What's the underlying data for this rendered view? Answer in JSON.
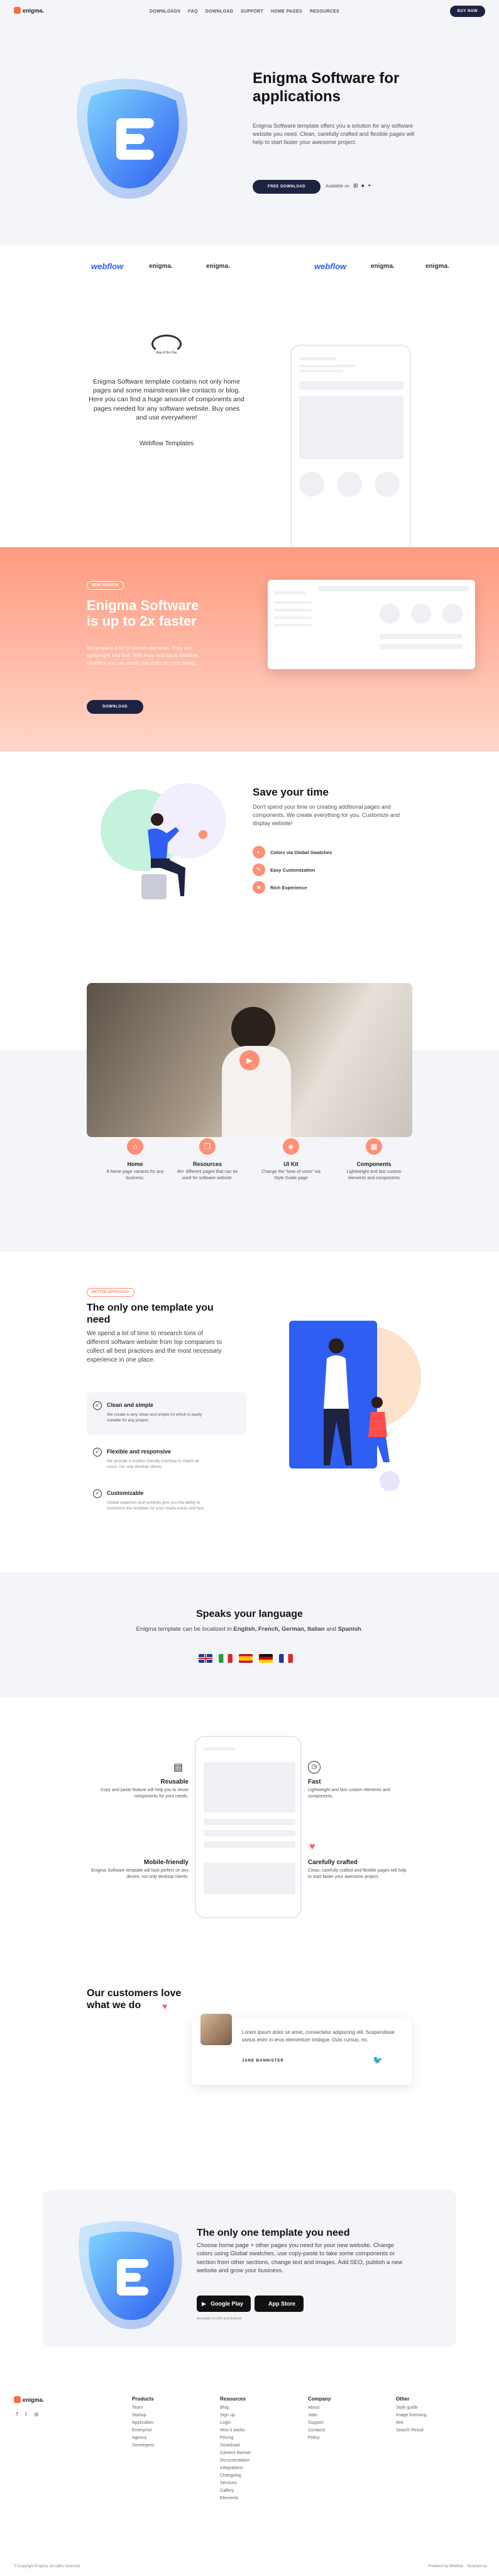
{
  "nav": {
    "logo": "enigma.",
    "links": [
      "DOWNLOADS",
      "FAQ",
      "DOWNLOAD",
      "SUPPORT",
      "HOME PAGES",
      "RESOURCES"
    ],
    "buy": "BUY NOW"
  },
  "hero": {
    "title": "Enigma Software for applications",
    "text": "Enigma Software template offers you a solution for any software website you need. Clean, carefully crafted and flexible pages will help to start faster your awesome project.",
    "button": "FREE DOWNLOAD",
    "available": "Available on"
  },
  "logos": [
    "webflow",
    "enigma.",
    "enigma.",
    "webflow",
    "enigma.",
    "enigma."
  ],
  "about": {
    "badge": "App of the Day",
    "text": "Enigma Software template contains not only home pages and some mainstream like contacts or blog. Here you can find a huge amount of components and pages needed for any software website. Buy ones and use everywhere!",
    "link": "Webflow Templates"
  },
  "promo": {
    "badge": "NEW VERSION",
    "title": "Enigma Software is up to 2x faster",
    "text": "We prepare a lot of custom elements. They are lightweight and fast. With easy and quick Webflow Interface you can easily use them for your needs.",
    "button": "DOWNLOAD"
  },
  "save": {
    "title": "Save your time",
    "text": "Don't spend your time on creating additional pages and components. We create everything for you. Customize and display website!",
    "items": [
      "Colors via Global Swatches",
      "Easy Customization",
      "Rich Experience"
    ]
  },
  "features": [
    {
      "title": "Home",
      "text": "8 home page variants for any business."
    },
    {
      "title": "Resources",
      "text": "40+ different pages that can be used for software website."
    },
    {
      "title": "UI Kit",
      "text": "Change the \"tone of voice\" via Style Guide page"
    },
    {
      "title": "Components",
      "text": "Lightweight and fast custom elements and components"
    }
  ],
  "better": {
    "badge": "BETTER APPROACH",
    "title": "The only one template you need",
    "text": "We spend a lot of time to research tons of different software website from top companies to collect all best practices and the most necessary experience in one place.",
    "items": [
      {
        "title": "Clean and simple",
        "text": "We create a very clean and simple UI which is easily suitable for any project."
      },
      {
        "title": "Flexible and responsive",
        "text": "We provide a modern friendly interface to match all users, not only desktop clients."
      },
      {
        "title": "Customizable",
        "text": "Global swatches and symbols give you the ability to customize the template for your needs easily and fast."
      }
    ]
  },
  "language": {
    "title": "Speaks your language",
    "text_pre": "Enigma template can be localized in ",
    "langs": "English, French, German, Italian",
    "and": " and ",
    "last": "Spanish",
    "end": "."
  },
  "quad": [
    {
      "title": "Reusable",
      "text": "Copy and paste feature will help you to reuse components for your needs."
    },
    {
      "title": "Fast",
      "text": "Lightweight and fast custom elements and components."
    },
    {
      "title": "Mobile-friendly",
      "text": "Enigma Software template will look perfect on any device, not only desktop clients."
    },
    {
      "title": "Carefully crafted",
      "text": "Clean, carefully crafted and flexible pages will help to start faster your awesome project."
    }
  ],
  "testimonial": {
    "title": "Our customers love what we do",
    "quote": "Lorem ipsum dolor sit amet, consectetur adipiscing elit. Suspendisse varius enim in eros elementum tristique. Duis cursus, mi.",
    "name": "JANE BANNISTER"
  },
  "cta": {
    "title": "The only one template you need",
    "text": "Choose home page + other pages you need for your new website. Change colors using Global swatches, use copy-paste to take some components or section from other sections, change text and images. Add SEO, publish a new website and grow your business.",
    "gp": "Google Play",
    "as": "App Store",
    "note": "Available on iOS and Android"
  },
  "footer": {
    "logo": "enigma.",
    "cols": [
      {
        "head": "Products",
        "items": [
          "Team",
          "Startup",
          "Application",
          "Enterprise",
          "Agency",
          "Developers"
        ]
      },
      {
        "head": "Resources",
        "items": [
          "Blog",
          "Sign up",
          "Login",
          "How it works",
          "Pricing",
          "Download",
          "Careers Banner",
          "Documentation",
          "Integrations",
          "Changelog",
          "Services",
          "Gallery",
          "Elements"
        ]
      },
      {
        "head": "Company",
        "items": [
          "About",
          "Jobs",
          "Support",
          "Contacts",
          "Policy"
        ]
      },
      {
        "head": "Other",
        "items": [
          "Style guide",
          "Image licensing",
          "404",
          "Search Result"
        ]
      }
    ],
    "copy": "© Copyright Enigma. All rights reserved.",
    "powered": "Powered by Webflow · Template by"
  },
  "colors": {
    "accent": "#ff8f75",
    "dark": "#1d2240",
    "blue": "#2e5ef2"
  }
}
